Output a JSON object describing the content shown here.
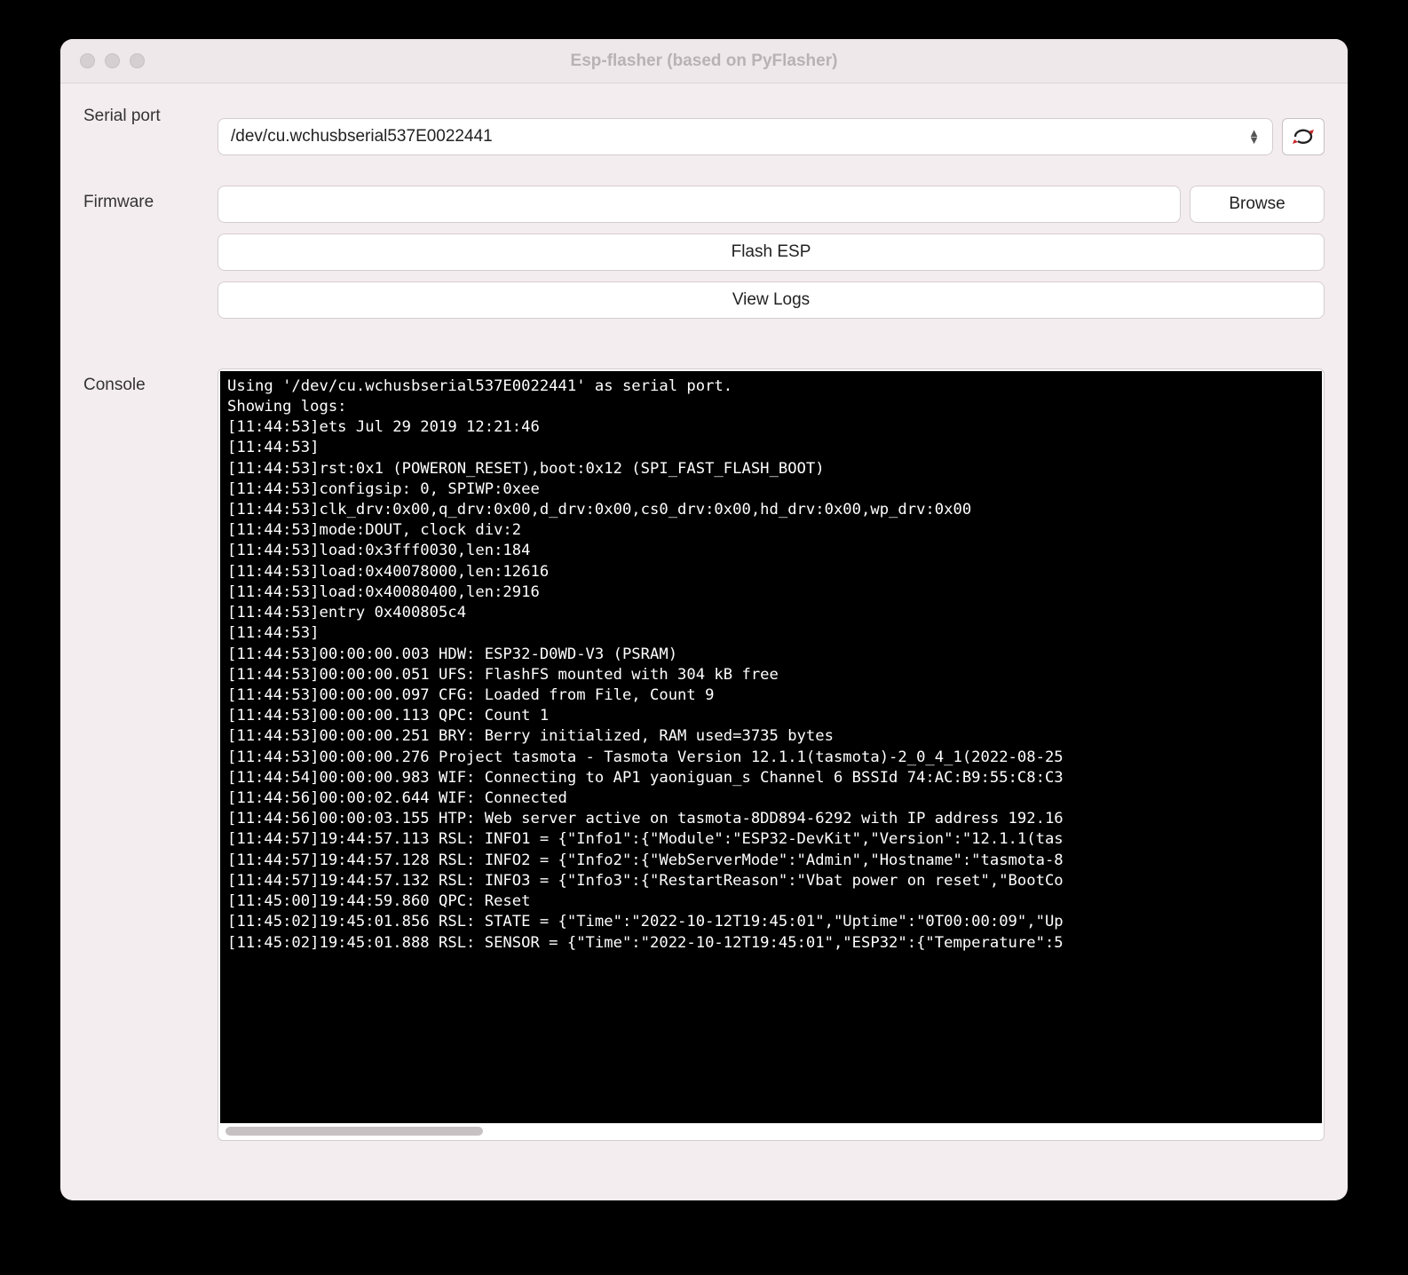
{
  "window": {
    "title": "Esp-flasher (based on PyFlasher)"
  },
  "labels": {
    "serial_port": "Serial port",
    "firmware": "Firmware",
    "console": "Console"
  },
  "serial_port": {
    "value": "/dev/cu.wchusbserial537E0022441"
  },
  "firmware": {
    "value": "",
    "browse": "Browse"
  },
  "buttons": {
    "flash": "Flash ESP",
    "view_logs": "View Logs"
  },
  "console": {
    "text": "Using '/dev/cu.wchusbserial537E0022441' as serial port.\nShowing logs:\n[11:44:53]ets Jul 29 2019 12:21:46\n[11:44:53]\n[11:44:53]rst:0x1 (POWERON_RESET),boot:0x12 (SPI_FAST_FLASH_BOOT)\n[11:44:53]configsip: 0, SPIWP:0xee\n[11:44:53]clk_drv:0x00,q_drv:0x00,d_drv:0x00,cs0_drv:0x00,hd_drv:0x00,wp_drv:0x00\n[11:44:53]mode:DOUT, clock div:2\n[11:44:53]load:0x3fff0030,len:184\n[11:44:53]load:0x40078000,len:12616\n[11:44:53]load:0x40080400,len:2916\n[11:44:53]entry 0x400805c4\n[11:44:53]\n[11:44:53]00:00:00.003 HDW: ESP32-D0WD-V3 (PSRAM)\n[11:44:53]00:00:00.051 UFS: FlashFS mounted with 304 kB free\n[11:44:53]00:00:00.097 CFG: Loaded from File, Count 9\n[11:44:53]00:00:00.113 QPC: Count 1\n[11:44:53]00:00:00.251 BRY: Berry initialized, RAM used=3735 bytes\n[11:44:53]00:00:00.276 Project tasmota - Tasmota Version 12.1.1(tasmota)-2_0_4_1(2022-08-25\n[11:44:54]00:00:00.983 WIF: Connecting to AP1 yaoniguan_s Channel 6 BSSId 74:AC:B9:55:C8:C3\n[11:44:56]00:00:02.644 WIF: Connected\n[11:44:56]00:00:03.155 HTP: Web server active on tasmota-8DD894-6292 with IP address 192.16\n[11:44:57]19:44:57.113 RSL: INFO1 = {\"Info1\":{\"Module\":\"ESP32-DevKit\",\"Version\":\"12.1.1(tas\n[11:44:57]19:44:57.128 RSL: INFO2 = {\"Info2\":{\"WebServerMode\":\"Admin\",\"Hostname\":\"tasmota-8\n[11:44:57]19:44:57.132 RSL: INFO3 = {\"Info3\":{\"RestartReason\":\"Vbat power on reset\",\"BootCo\n[11:45:00]19:44:59.860 QPC: Reset\n[11:45:02]19:45:01.856 RSL: STATE = {\"Time\":\"2022-10-12T19:45:01\",\"Uptime\":\"0T00:00:09\",\"Up\n[11:45:02]19:45:01.888 RSL: SENSOR = {\"Time\":\"2022-10-12T19:45:01\",\"ESP32\":{\"Temperature\":5"
  }
}
